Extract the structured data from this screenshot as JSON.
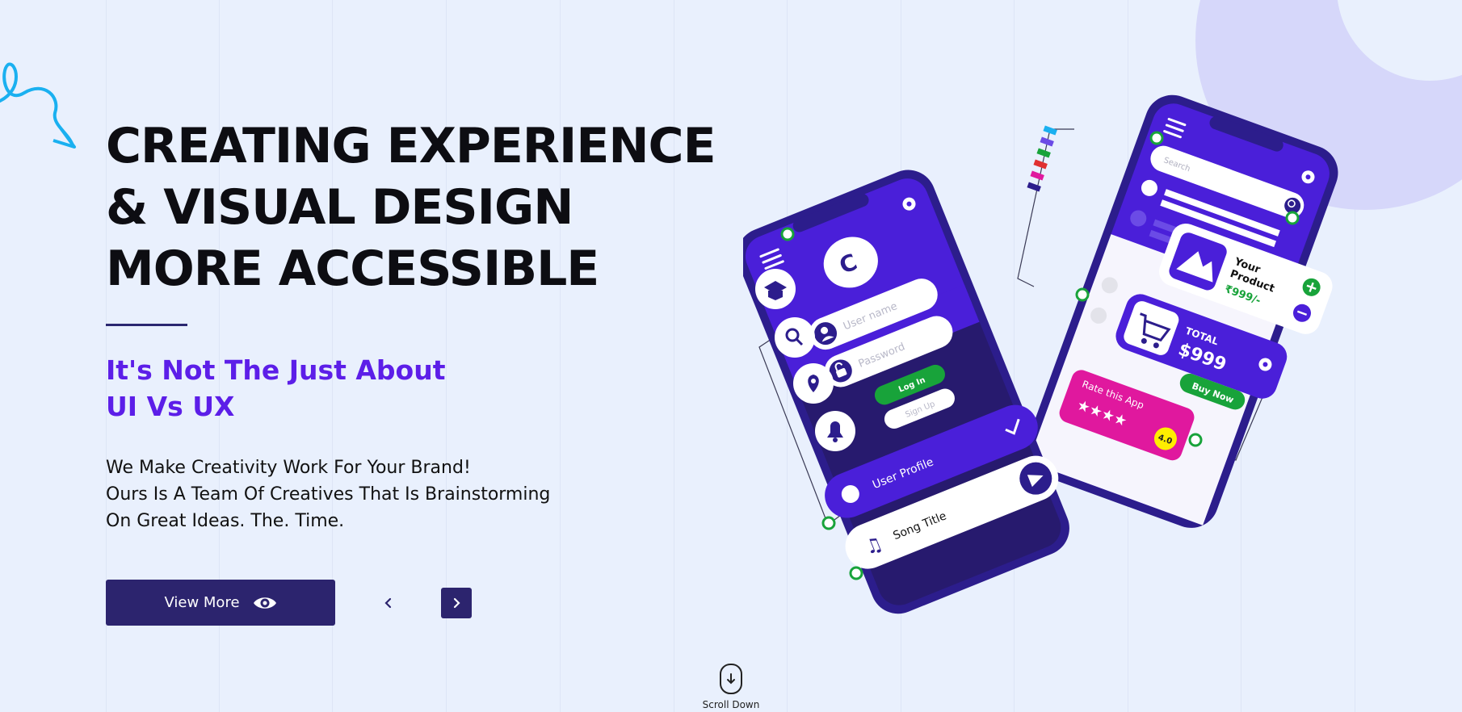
{
  "hero": {
    "headline": [
      "CREATING EXPERIENCE",
      "& VISUAL DESIGN",
      "MORE ACCESSIBLE"
    ],
    "subheading": [
      "It's Not The Just About",
      "UI Vs UX"
    ],
    "body": [
      "We Make Creativity Work For Your Brand!",
      "Ours Is A Team Of Creatives That Is Brainstorming",
      "On Great Ideas. The. Time."
    ],
    "cta_label": "View More",
    "scroll_label": "Scroll Down"
  },
  "phone_left": {
    "username_placeholder": "User name",
    "password_placeholder": "Password",
    "login_label": "Log In",
    "signup_label": "Sign Up",
    "profile_label": "User Profile",
    "song_label": "Song Title"
  },
  "phone_right": {
    "search_placeholder": "Search",
    "product_label_line1": "Your",
    "product_label_line2": "Product",
    "product_price": "₹999/-",
    "total_label": "TOTAL",
    "total_value": "$999",
    "buy_label": "Buy Now",
    "rate_label": "Rate this App",
    "rating_value": "4.0"
  },
  "icons": {
    "cta": "eye-icon",
    "prev": "chevron-left-icon",
    "next": "chevron-right-icon",
    "scroll": "mouse-down-arrow-icon"
  },
  "colors": {
    "brand_dark": "#2c246e",
    "accent_purple": "#5c1ee8",
    "phone_purple": "#4a1fd9",
    "green": "#18a33a",
    "magenta": "#e0189e",
    "background": "#e9f0fd"
  }
}
